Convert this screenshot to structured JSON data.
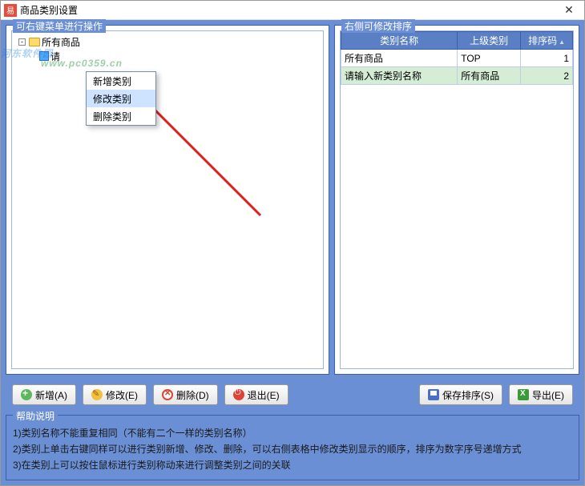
{
  "window": {
    "title": "商品类别设置"
  },
  "left_panel": {
    "legend": "可右键菜单进行操作",
    "root_label": "所有商品",
    "child_label": "请"
  },
  "context_menu": {
    "item_new": "新增类别",
    "item_edit": "修改类别",
    "item_delete": "删除类别"
  },
  "right_panel": {
    "legend": "右侧可修改排序",
    "col_name": "类别名称",
    "col_parent": "上级类别",
    "col_order": "排序码",
    "rows": [
      {
        "name": "所有商品",
        "parent": "TOP",
        "order": "1"
      },
      {
        "name": "请输入新类别名称",
        "parent": "所有商品",
        "order": "2"
      }
    ]
  },
  "toolbar": {
    "add": "新增(A)",
    "edit": "修改(E)",
    "delete": "删除(D)",
    "exit": "退出(E)",
    "save": "保存排序(S)",
    "export": "导出(E)"
  },
  "help": {
    "legend": "帮助说明",
    "line1": "1)类别名称不能重复相同（不能有二个一样的类别名称）",
    "line2": "2)类别上单击右键同样可以进行类别新增、修改、删除，可以右侧表格中修改类别显示的顺序，排序为数字序号递增方式",
    "line3": "3)在类别上可以按住鼠标进行类别称动来进行调整类别之间的关联"
  },
  "watermark": {
    "main": "河东软件园",
    "sub": "www.pc0359.cn"
  }
}
